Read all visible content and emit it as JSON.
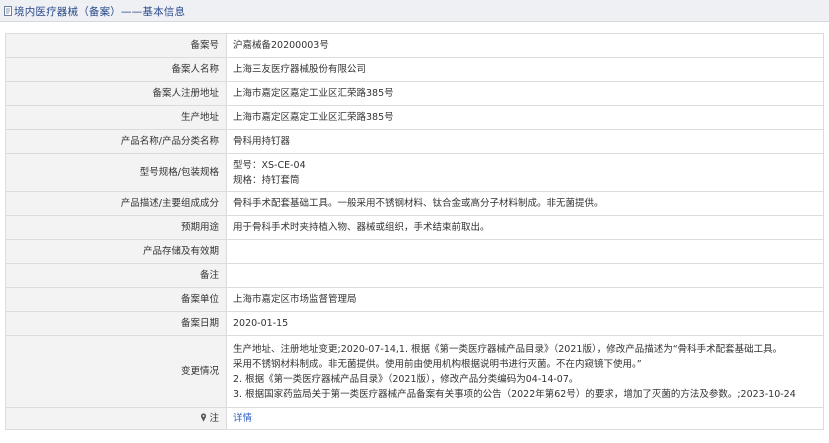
{
  "header": {
    "title": "境内医疗器械（备案）——基本信息"
  },
  "rows": [
    {
      "label": "备案号",
      "value": "沪嘉械备20200003号"
    },
    {
      "label": "备案人名称",
      "value": "上海三友医疗器械股份有限公司"
    },
    {
      "label": "备案人注册地址",
      "value": "上海市嘉定区嘉定工业区汇荣路385号"
    },
    {
      "label": "生产地址",
      "value": "上海市嘉定区嘉定工业区汇荣路385号"
    },
    {
      "label": "产品名称/产品分类名称",
      "value": "骨科用持钉器"
    },
    {
      "label": "型号规格/包装规格",
      "lines": [
        "型号：XS-CE-04",
        "规格：持钉套筒"
      ]
    },
    {
      "label": "产品描述/主要组成成分",
      "value": "骨科手术配套基础工具。一般采用不锈钢材料、钛合金或高分子材料制成。非无菌提供。"
    },
    {
      "label": "预期用途",
      "value": "用于骨科手术时夹持植入物、器械或组织，手术结束前取出。"
    },
    {
      "label": "产品存储及有效期",
      "value": ""
    },
    {
      "label": "备注",
      "value": ""
    },
    {
      "label": "备案单位",
      "value": "上海市嘉定区市场监督管理局"
    },
    {
      "label": "备案日期",
      "value": "2020-01-15"
    },
    {
      "label": "变更情况",
      "lines": [
        "生产地址、注册地址变更;2020-07-14,1. 根据《第一类医疗器械产品目录》（2021版），修改产品描述为“骨科手术配套基础工具。",
        "采用不锈钢材料制成。非无菌提供。使用前由使用机构根据说明书进行灭菌。不在内窥镜下使用。”",
        "2. 根据《第一类医疗器械产品目录》（2021版），修改产品分类编码为04-14-07。",
        "3. 根据国家药监局关于第一类医疗器械产品备案有关事项的公告（2022年第62号）的要求，增加了灭菌的方法及参数。;2023-10-24"
      ]
    }
  ],
  "note": {
    "label": "注",
    "link": "详情"
  },
  "icons": {
    "header": "document-icon",
    "note": "pin-icon"
  },
  "colors": {
    "header_bg": "#eef0f3",
    "header_text": "#2b4a8c",
    "label_bg": "#f3f3f3",
    "link": "#2f5fbf"
  }
}
